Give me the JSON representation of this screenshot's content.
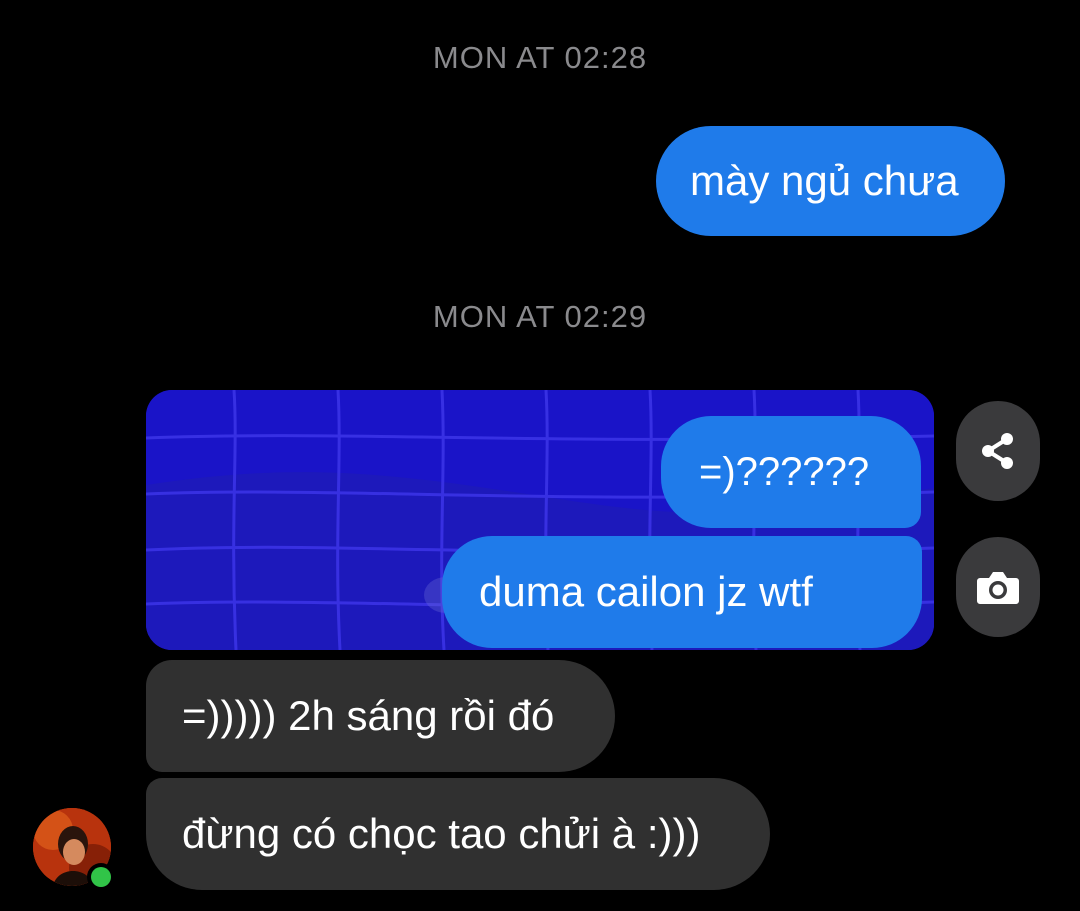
{
  "conversation": {
    "timestamps": [
      "MON AT 02:28",
      "MON AT 02:29"
    ],
    "messages": [
      {
        "direction": "outgoing",
        "text": "mày ngủ chưa"
      },
      {
        "direction": "outgoing",
        "text": "=)??????",
        "part_of": "reply-card"
      },
      {
        "direction": "outgoing",
        "text": "duma cailon jz wtf",
        "part_of": "reply-card"
      },
      {
        "direction": "incoming",
        "text": "=))))) 2h sáng rồi đó"
      },
      {
        "direction": "incoming",
        "text": "đừng có chọc tao chửi à :)))"
      }
    ]
  },
  "actions": {
    "share_icon": "share-icon",
    "camera_icon": "camera-icon"
  },
  "contact": {
    "avatar_icon": "avatar",
    "online": true
  },
  "colors": {
    "background": "#000000",
    "outgoing_bubble": "#1f7bea",
    "incoming_bubble": "#303030",
    "reply_card": "#1a14c8",
    "timestamp_text": "#8a8a8d",
    "online_indicator": "#31c448"
  }
}
